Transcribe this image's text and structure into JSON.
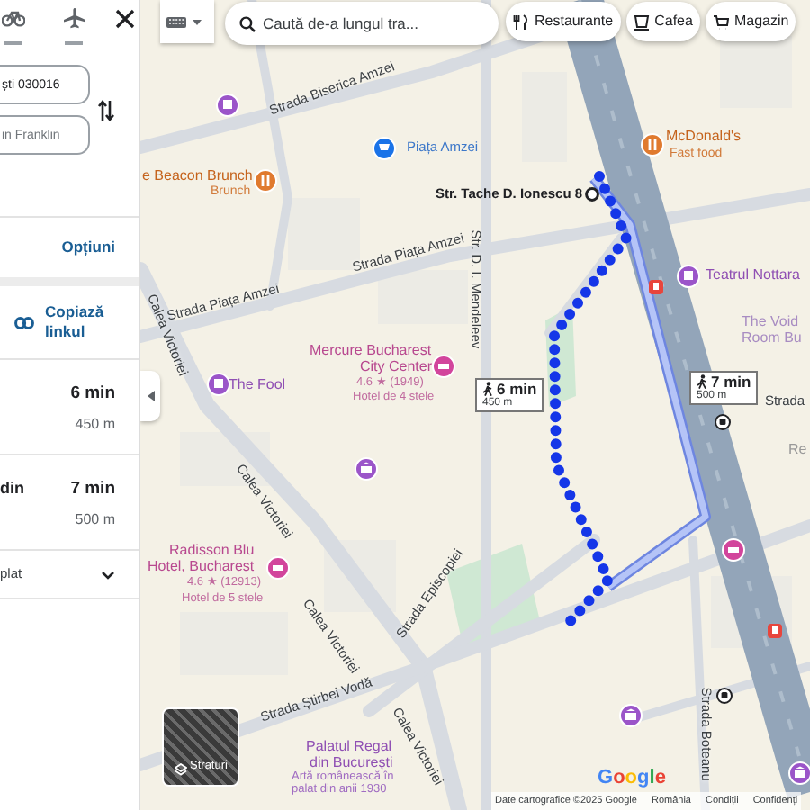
{
  "panel": {
    "origin_value": "ști 030016",
    "destination_value": "in Franklin",
    "options_link": "Opțiuni",
    "copy_link": "Copiază linkul",
    "routes": [
      {
        "time": "6 min",
        "distance": "450 m"
      },
      {
        "label": "din",
        "time": "7 min",
        "distance": "500 m"
      }
    ],
    "details_label": "plat"
  },
  "map": {
    "search_placeholder": "Caută de-a lungul tra...",
    "chips": [
      "Restaurante",
      "Cafea",
      "Magazin"
    ],
    "labels": [
      {
        "text": "Strada Biserica Amzei",
        "kind": "street"
      },
      {
        "text": "Piața Amzei",
        "kind": "square"
      },
      {
        "text": "e Beacon Brunch",
        "kind": "food"
      },
      {
        "text": "Brunch",
        "kind": "food-sub"
      },
      {
        "text": "McDonald's",
        "kind": "food"
      },
      {
        "text": "Fast food",
        "kind": "food-sub"
      },
      {
        "text": "Str. Tache D. Ionescu 8",
        "kind": "address"
      },
      {
        "text": "Strada Piața Amzei",
        "kind": "street"
      },
      {
        "text": "Strada Piața Amzei",
        "kind": "street"
      },
      {
        "text": "Str. D. I. Mendeleev",
        "kind": "street"
      },
      {
        "text": "Teatrul Nottara",
        "kind": "culture"
      },
      {
        "text": "The Void",
        "kind": "culture-faded"
      },
      {
        "text": "Room Bu",
        "kind": "culture-faded"
      },
      {
        "text": "Mercure Bucharest",
        "kind": "hotel"
      },
      {
        "text": "City Center",
        "kind": "hotel"
      },
      {
        "text": "4.6 ★ (1949)",
        "kind": "hotel-sub"
      },
      {
        "text": "Hotel de 4 stele",
        "kind": "hotel-sub"
      },
      {
        "text": "The Fool",
        "kind": "culture"
      },
      {
        "text": "Calea Victoriei",
        "kind": "street"
      },
      {
        "text": "Calea Victoriei",
        "kind": "street"
      },
      {
        "text": "Calea Victoriei",
        "kind": "street"
      },
      {
        "text": "Radisson Blu",
        "kind": "hotel"
      },
      {
        "text": "Hotel, Bucharest",
        "kind": "hotel"
      },
      {
        "text": "4.6 ★ (12913)",
        "kind": "hotel-sub"
      },
      {
        "text": "Hotel de 5 stele",
        "kind": "hotel-sub"
      },
      {
        "text": "Strada Știrbei Vodă",
        "kind": "street"
      },
      {
        "text": "Strada Episcopiei",
        "kind": "street"
      },
      {
        "text": "Calea Victoriei",
        "kind": "street"
      },
      {
        "text": "Palatul Regal",
        "kind": "culture"
      },
      {
        "text": "din București",
        "kind": "culture"
      },
      {
        "text": "Artă românească în",
        "kind": "culture-sub"
      },
      {
        "text": "palat din anii 1930",
        "kind": "culture-sub"
      },
      {
        "text": "Strada Boteanu",
        "kind": "street"
      },
      {
        "text": "Strada",
        "kind": "street"
      },
      {
        "text": "Re",
        "kind": "faded"
      }
    ],
    "route_callouts": [
      {
        "time": "6 min",
        "distance": "450 m"
      },
      {
        "time": "7 min",
        "distance": "500 m"
      }
    ],
    "layers_label": "Straturi",
    "logo": "Google",
    "attribution": [
      "Date cartografice ©2025 Google",
      "România",
      "Condiții",
      "Confidenți"
    ]
  }
}
